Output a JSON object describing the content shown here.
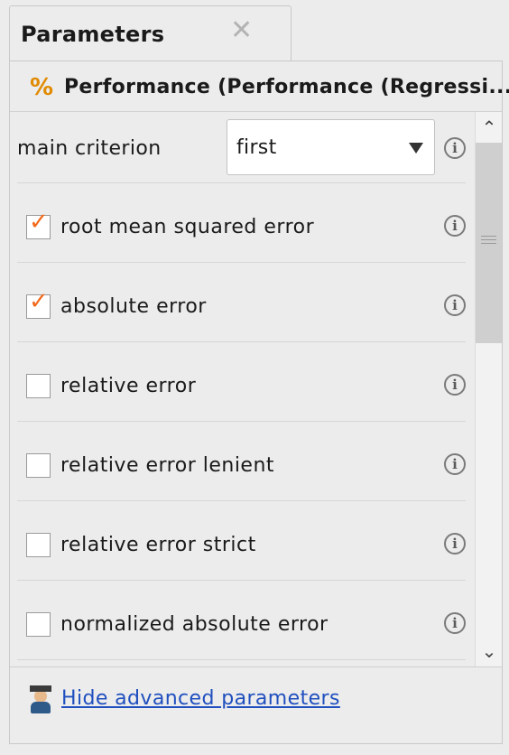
{
  "tab": {
    "title": "Parameters",
    "close_glyph": "✕"
  },
  "operator": {
    "icon": "percent-icon",
    "icon_glyph": "%",
    "title": "Performance (Performance (Regressi..."
  },
  "main_criterion": {
    "label": "main criterion",
    "value": "first"
  },
  "info_glyph": "i",
  "check_glyph": "✓",
  "params": [
    {
      "label": "root mean squared error",
      "checked": true
    },
    {
      "label": "absolute error",
      "checked": true
    },
    {
      "label": "relative error",
      "checked": false
    },
    {
      "label": "relative error lenient",
      "checked": false
    },
    {
      "label": "relative error strict",
      "checked": false
    },
    {
      "label": "normalized absolute error",
      "checked": false
    }
  ],
  "scrollbar": {
    "up_glyph": "⌃",
    "down_glyph": "⌄"
  },
  "footer": {
    "link_text": "Hide advanced parameters"
  },
  "colors": {
    "accent_check": "#f26a1b",
    "link": "#1f4fbf"
  }
}
